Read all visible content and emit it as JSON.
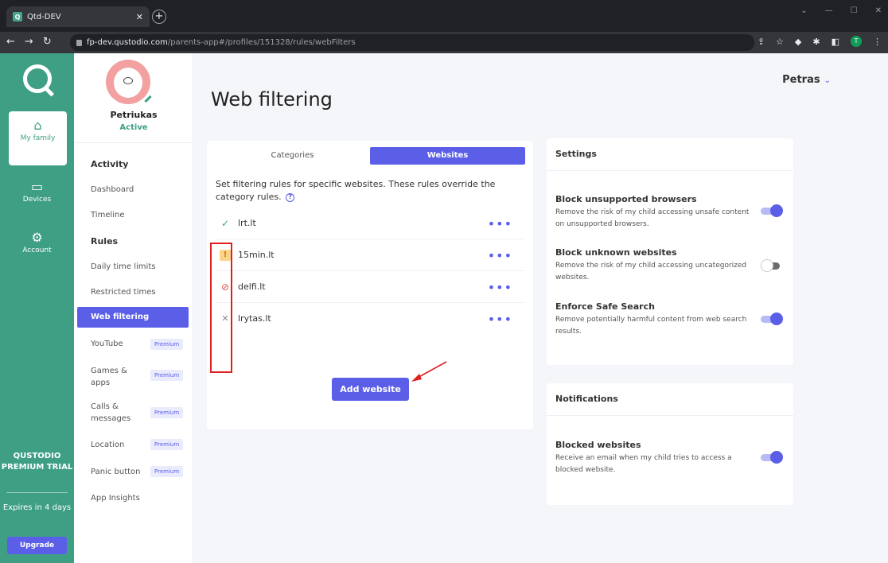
{
  "browser": {
    "tab_title": "Qtd-DEV",
    "tab_favicon": "Q",
    "url_domain": "fp-dev.qustodio.com",
    "url_path": "/parents-app#/profiles/151328/rules/webFilters",
    "profile_initial": "T"
  },
  "rail": {
    "my_family": "My family",
    "devices": "Devices",
    "account": "Account",
    "trial": "QUSTODIO PREMIUM TRIAL",
    "expires": "Expires in 4 days",
    "upgrade": "Upgrade"
  },
  "profile": {
    "name": "Petriukas",
    "status": "Active"
  },
  "sidebar": {
    "activity_head": "Activity",
    "dashboard": "Dashboard",
    "timeline": "Timeline",
    "rules_head": "Rules",
    "daily_time_limits": "Daily time limits",
    "restricted_times": "Restricted times",
    "web_filtering": "Web filtering",
    "youtube": "YouTube",
    "games_apps": "Games & apps",
    "calls_messages": "Calls & messages",
    "location": "Location",
    "panic_button": "Panic button",
    "app_insights": "App Insights",
    "premium_badge": "Premium"
  },
  "header": {
    "page_title": "Web filtering",
    "user_name": "Petras"
  },
  "web_card": {
    "tab_categories": "Categories",
    "tab_websites": "Websites",
    "intro": "Set filtering rules for specific websites. These rules override the category rules.",
    "sites": [
      {
        "name": "lrt.lt",
        "rule": "allowed"
      },
      {
        "name": "15min.lt",
        "rule": "alert"
      },
      {
        "name": "delfi.lt",
        "rule": "blocked"
      },
      {
        "name": "lrytas.lt",
        "rule": "ignored"
      }
    ],
    "add_label": "Add website"
  },
  "settings": {
    "head": "Settings",
    "items": [
      {
        "title": "Block unsupported browsers",
        "desc": "Remove the risk of my child accessing unsafe content on unsupported browsers.",
        "enabled": true
      },
      {
        "title": "Block unknown websites",
        "desc": "Remove the risk of my child accessing uncategorized websites.",
        "enabled": false
      },
      {
        "title": "Enforce Safe Search",
        "desc": "Remove potentially harmful content from web search results.",
        "enabled": true
      }
    ]
  },
  "notifications": {
    "head": "Notifications",
    "items": [
      {
        "title": "Blocked websites",
        "desc": "Receive an email when my child tries to access a blocked website.",
        "enabled": true
      }
    ]
  },
  "colors": {
    "brand_green": "#3e9f85",
    "accent_purple": "#5b5fe8",
    "annotation_red": "#e02020"
  }
}
